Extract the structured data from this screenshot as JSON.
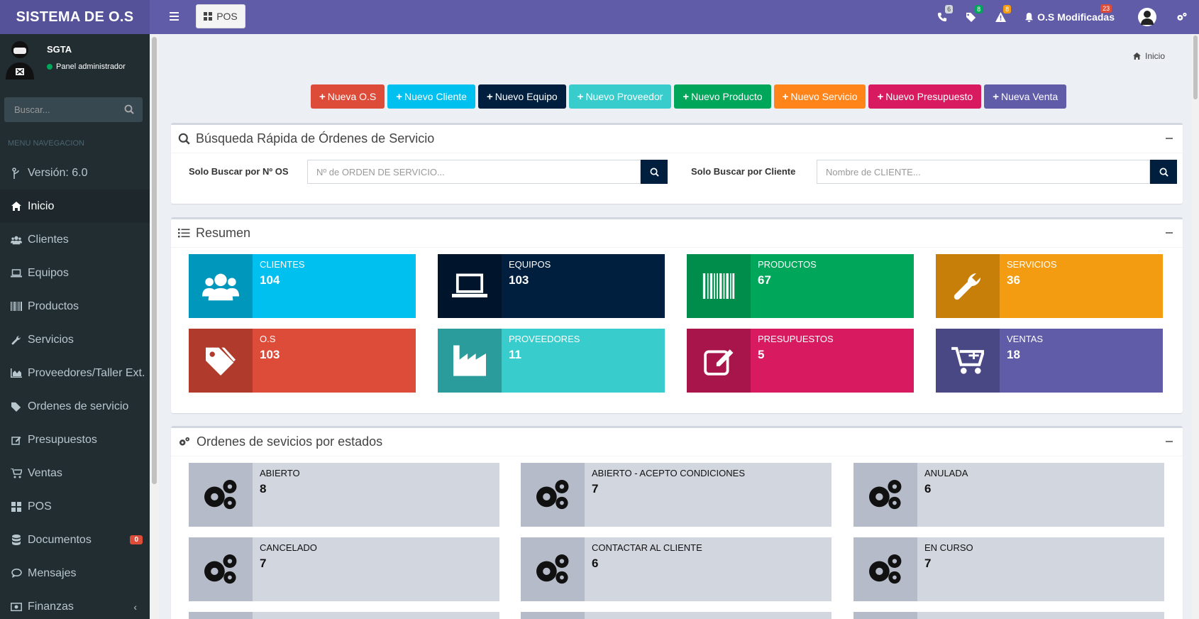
{
  "app": {
    "title": "SISTEMA DE O.S"
  },
  "header": {
    "pos_label": "POS",
    "notifications": [
      {
        "icon": "phone-icon",
        "count": "6",
        "color": "#d2d6de"
      },
      {
        "icon": "tags-icon",
        "count": "8",
        "color": "#00a65a"
      },
      {
        "icon": "warning-icon",
        "count": "8",
        "color": "#f39c12"
      }
    ],
    "modified_label": "O.S Modificadas",
    "modified_count": "23"
  },
  "user": {
    "name": "SGTA",
    "role": "Panel administrador"
  },
  "sidebar": {
    "search_placeholder": "Buscar...",
    "menu_header": "MENU NAVEGACION",
    "items": [
      {
        "label": "Versión: 6.0",
        "icon": "code-branch-icon"
      },
      {
        "label": "Inicio",
        "icon": "home-icon"
      },
      {
        "label": "Clientes",
        "icon": "users-icon"
      },
      {
        "label": "Equipos",
        "icon": "laptop-icon"
      },
      {
        "label": "Productos",
        "icon": "barcode-icon"
      },
      {
        "label": "Servicios",
        "icon": "wrench-icon"
      },
      {
        "label": "Proveedores/Taller Ext.",
        "icon": "chart-area-icon"
      },
      {
        "label": "Ordenes de servicio",
        "icon": "tags-icon"
      },
      {
        "label": "Presupuestos",
        "icon": "edit-icon"
      },
      {
        "label": "Ventas",
        "icon": "cart-icon"
      },
      {
        "label": "POS",
        "icon": "grid-icon"
      },
      {
        "label": "Documentos",
        "icon": "database-icon",
        "badge": "0"
      },
      {
        "label": "Mensajes",
        "icon": "comment-icon"
      },
      {
        "label": "Finanzas",
        "icon": "money-icon"
      }
    ]
  },
  "breadcrumb": {
    "label": "Inicio"
  },
  "quick_actions": [
    {
      "label": "Nueva O.S",
      "color": "#dd4b39"
    },
    {
      "label": "Nuevo Cliente",
      "color": "#00c0ef"
    },
    {
      "label": "Nuevo Equipo",
      "color": "#001f3f"
    },
    {
      "label": "Nuevo Proveedor",
      "color": "#39cccc"
    },
    {
      "label": "Nuevo Producto",
      "color": "#00a65a"
    },
    {
      "label": "Nuevo Servicio",
      "color": "#ff851b"
    },
    {
      "label": "Nuevo Presupuesto",
      "color": "#d81b60"
    },
    {
      "label": "Nueva Venta",
      "color": "#605ca8"
    }
  ],
  "quick_search": {
    "title": "Búsqueda Rápida de Órdenes de Servicio",
    "os_label": "Solo Buscar por Nº OS",
    "os_placeholder": "Nº de ORDEN DE SERVICIO...",
    "client_label": "Solo Buscar por Cliente",
    "client_placeholder": "Nombre de CLIENTE..."
  },
  "summary": {
    "title": "Resumen",
    "tiles": [
      {
        "label": "CLIENTES",
        "value": "104",
        "color": "#00c0ef",
        "icon_bg": "#0097bc",
        "icon": "users-icon"
      },
      {
        "label": "EQUIPOS",
        "value": "103",
        "color": "#001f3f",
        "icon_bg": "#00152b",
        "icon": "laptop-icon"
      },
      {
        "label": "PRODUCTOS",
        "value": "67",
        "color": "#00a65a",
        "icon_bg": "#008d4c",
        "icon": "barcode-icon"
      },
      {
        "label": "SERVICIOS",
        "value": "36",
        "color": "#f39c12",
        "icon_bg": "#c87f0a",
        "icon": "wrench-icon"
      },
      {
        "label": "O.S",
        "value": "103",
        "color": "#dd4b39",
        "icon_bg": "#b03a2b",
        "icon": "tags-icon"
      },
      {
        "label": "PROVEEDORES",
        "value": "11",
        "color": "#39cccc",
        "icon_bg": "#2a9c9c",
        "icon": "industry-icon"
      },
      {
        "label": "PRESUPUESTOS",
        "value": "5",
        "color": "#d81b60",
        "icon_bg": "#a8154a",
        "icon": "edit-icon"
      },
      {
        "label": "VENTAS",
        "value": "18",
        "color": "#605ca8",
        "icon_bg": "#4a4785",
        "icon": "cart-plus-icon"
      }
    ]
  },
  "status_box": {
    "title": "Ordenes de sevicios por estados",
    "tiles": [
      {
        "label": "ABIERTO",
        "value": "8"
      },
      {
        "label": "ABIERTO - ACEPTO CONDICIONES",
        "value": "7"
      },
      {
        "label": "ANULADA",
        "value": "6"
      },
      {
        "label": "CANCELADO",
        "value": "7"
      },
      {
        "label": "CONTACTAR AL CLIENTE",
        "value": "6"
      },
      {
        "label": "EN CURSO",
        "value": "7"
      }
    ]
  }
}
